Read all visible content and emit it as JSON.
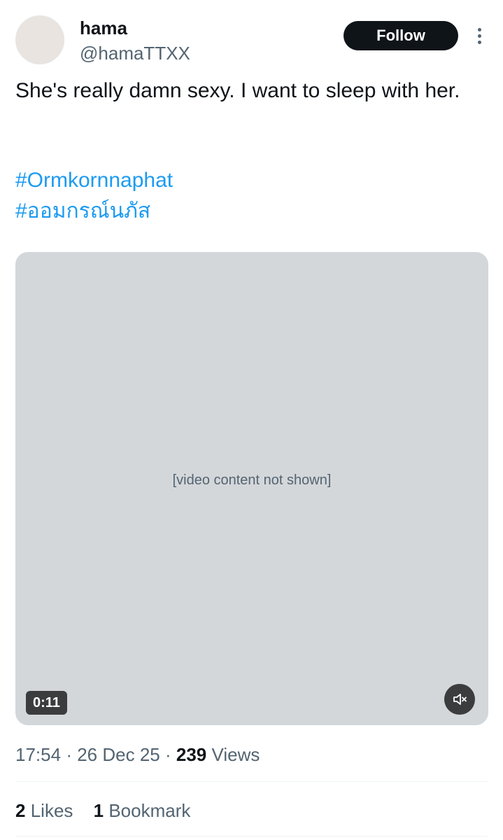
{
  "author": {
    "name": "hama",
    "handle": "@hamaTTXX",
    "follow_label": "Follow"
  },
  "tweet": {
    "text": "She's really damn sexy. I want to sleep with her.",
    "hashtags": [
      "#Ormkornnaphat",
      "#ออมกรณ์นภัส"
    ]
  },
  "media": {
    "placeholder_note": "[video content not shown]",
    "duration": "0:11",
    "muted": true
  },
  "meta": {
    "time": "17:54",
    "date": "26 Dec 25",
    "views_count": "239",
    "views_label": "Views",
    "separator": "·"
  },
  "engagement": {
    "likes_count": "2",
    "likes_label": "Likes",
    "bookmarks_count": "1",
    "bookmarks_label": "Bookmark"
  },
  "colors": {
    "link": "#1d9bf0",
    "text": "#0f1419",
    "secondary": "#536471"
  }
}
